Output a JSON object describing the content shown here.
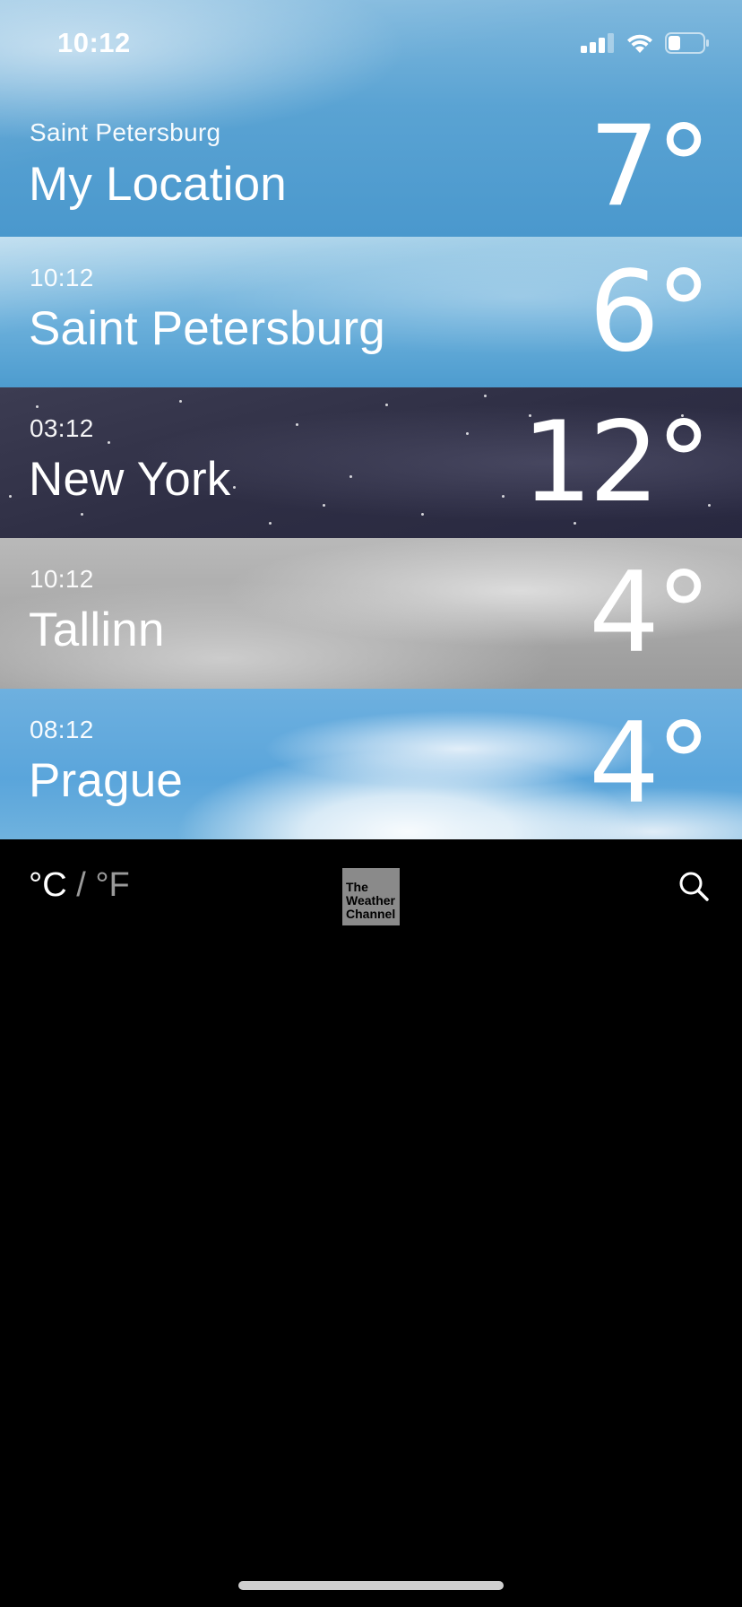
{
  "status_bar": {
    "time": "10:12",
    "icons": [
      "signal-icon",
      "wifi-icon",
      "battery-icon"
    ]
  },
  "cities": [
    {
      "subtitle": "Saint Petersburg",
      "name": "My Location",
      "temp": "7°",
      "theme": "sky"
    },
    {
      "subtitle": "10:12",
      "name": "Saint Petersburg",
      "temp": "6°",
      "theme": "sky-light"
    },
    {
      "subtitle": "03:12",
      "name": "New York",
      "temp": "12°",
      "theme": "night"
    },
    {
      "subtitle": "10:12",
      "name": "Tallinn",
      "temp": "4°",
      "theme": "cloudy"
    },
    {
      "subtitle": "08:12",
      "name": "Prague",
      "temp": "4°",
      "theme": "sunny-clouds"
    }
  ],
  "toolbar": {
    "unit_celsius": "°C",
    "unit_separator": " / ",
    "unit_fahrenheit": "°F",
    "logo_lines": [
      "The",
      "Weather",
      "Channel"
    ],
    "search_icon": "search-icon"
  },
  "colors": {
    "background": "#000000",
    "inactive_unit": "#9a9a9a",
    "logo_bg": "#8a8a8a"
  }
}
